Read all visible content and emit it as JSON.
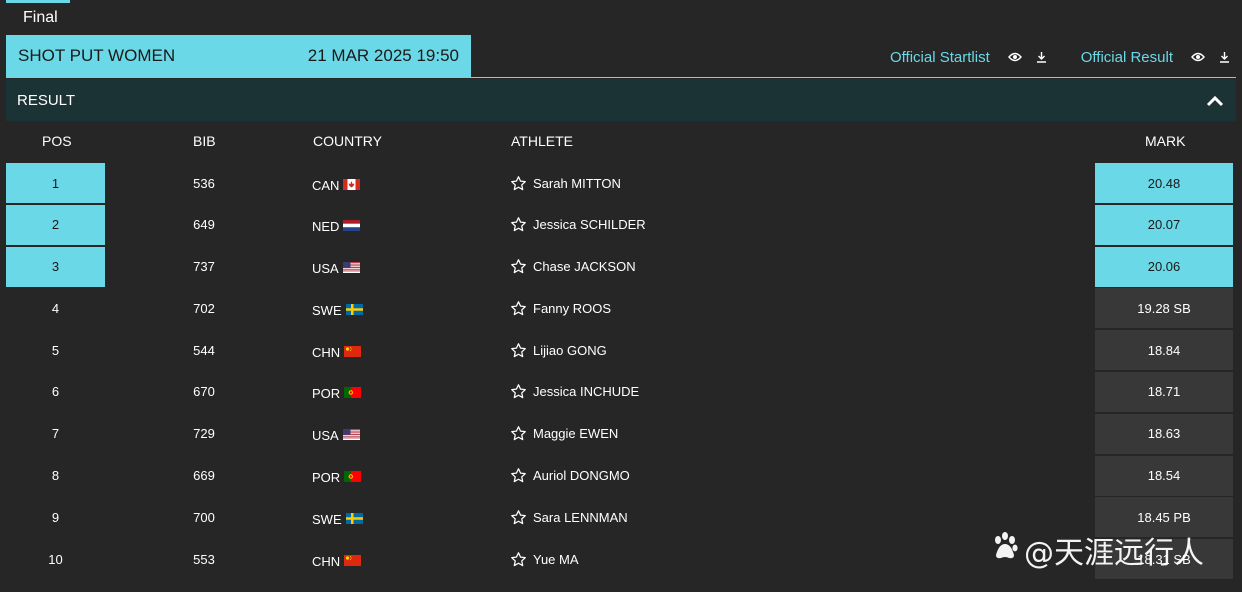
{
  "tab": {
    "label": "Final"
  },
  "event": {
    "name": "SHOT PUT WOMEN",
    "datetime": "21 MAR 2025 19:50"
  },
  "links": {
    "startlist": "Official Startlist",
    "result": "Official Result"
  },
  "section": {
    "title": "RESULT"
  },
  "columns": {
    "pos": "POS",
    "bib": "BIB",
    "country": "COUNTRY",
    "athlete": "ATHLETE",
    "mark": "MARK"
  },
  "rows": [
    {
      "pos": "1",
      "bib": "536",
      "country": "CAN",
      "flag": "canada-flag",
      "athlete": "Sarah MITTON",
      "mark": "20.48"
    },
    {
      "pos": "2",
      "bib": "649",
      "country": "NED",
      "flag": "netherlands-flag",
      "athlete": "Jessica SCHILDER",
      "mark": "20.07"
    },
    {
      "pos": "3",
      "bib": "737",
      "country": "USA",
      "flag": "usa-flag",
      "athlete": "Chase JACKSON",
      "mark": "20.06"
    },
    {
      "pos": "4",
      "bib": "702",
      "country": "SWE",
      "flag": "sweden-flag",
      "athlete": "Fanny ROOS",
      "mark": "19.28 SB"
    },
    {
      "pos": "5",
      "bib": "544",
      "country": "CHN",
      "flag": "china-flag",
      "athlete": "Lijiao GONG",
      "mark": "18.84"
    },
    {
      "pos": "6",
      "bib": "670",
      "country": "POR",
      "flag": "portugal-flag",
      "athlete": "Jessica INCHUDE",
      "mark": "18.71"
    },
    {
      "pos": "7",
      "bib": "729",
      "country": "USA",
      "flag": "usa-flag",
      "athlete": "Maggie EWEN",
      "mark": "18.63"
    },
    {
      "pos": "8",
      "bib": "669",
      "country": "POR",
      "flag": "portugal-flag",
      "athlete": "Auriol DONGMO",
      "mark": "18.54"
    },
    {
      "pos": "9",
      "bib": "700",
      "country": "SWE",
      "flag": "sweden-flag",
      "athlete": "Sara LENNMAN",
      "mark": "18.45 PB"
    },
    {
      "pos": "10",
      "bib": "553",
      "country": "CHN",
      "flag": "china-flag",
      "athlete": "Yue MA",
      "mark": "18.31 SB"
    }
  ],
  "watermark": {
    "text": "@天涯远行人"
  },
  "colors": {
    "accent": "#6ad8e6",
    "background": "#262626",
    "header_bg": "#1c3336",
    "mark_bg": "#383838"
  }
}
